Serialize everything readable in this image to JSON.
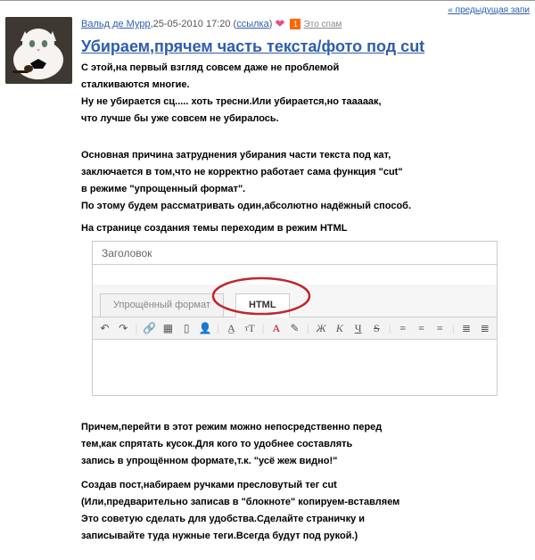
{
  "nav": {
    "prev": "« предыдущая запи"
  },
  "meta": {
    "author": "Вальд де Мурр",
    "date": ",25-05-2010 17:20 (",
    "permalink": "ссылка",
    "close": ")",
    "spam_badge": "1",
    "spam_link": "Это спам"
  },
  "title": "Убираем,прячем часть текста/фото под cut",
  "body": {
    "p1a": "С этой,на первый взгляд совсем даже не проблемой",
    "p1b": "сталкиваются многие.",
    "p1c": "Ну не убирается сц..... хоть тресни.Или убирается,но тааааак,",
    "p1d": "что лучше бы уже совсем не убиралось.",
    "p2a": "Основная причина затруднения убирания части текста под кат,",
    "p2b": "заключается в том,что не корректно работает сама функция \"cut\"",
    "p2c": "в режиме \"упрощенный формат\".",
    "p2d": "По этому будем рассматривать один,абсолютно надёжный способ.",
    "p3": "На странице создания темы переходим в режим НТМL",
    "p4a": "Причем,перейти в этот режим можно непосредственно перед",
    "p4b": "тем,как спрятать кусок.Для кого то удобнее составлять",
    "p4c": "запись в упрощённом формате,т.к. \"усё жеж видно!\"",
    "p5a": "Создав пост,набираем ручками пресловутый тег cut",
    "p5b": "(Или,предварительно записав в \"блокноте\" копируем-вставляем",
    "p5c": "Это советую сделать для удобства.Сделайте страничку и",
    "p5d": "записывайте туда нужные теги.Всегда будут под рукой.)"
  },
  "editor": {
    "field_label": "Заголовок",
    "tab_simple": "Упрощённый формат",
    "tab_html": "HTML"
  }
}
